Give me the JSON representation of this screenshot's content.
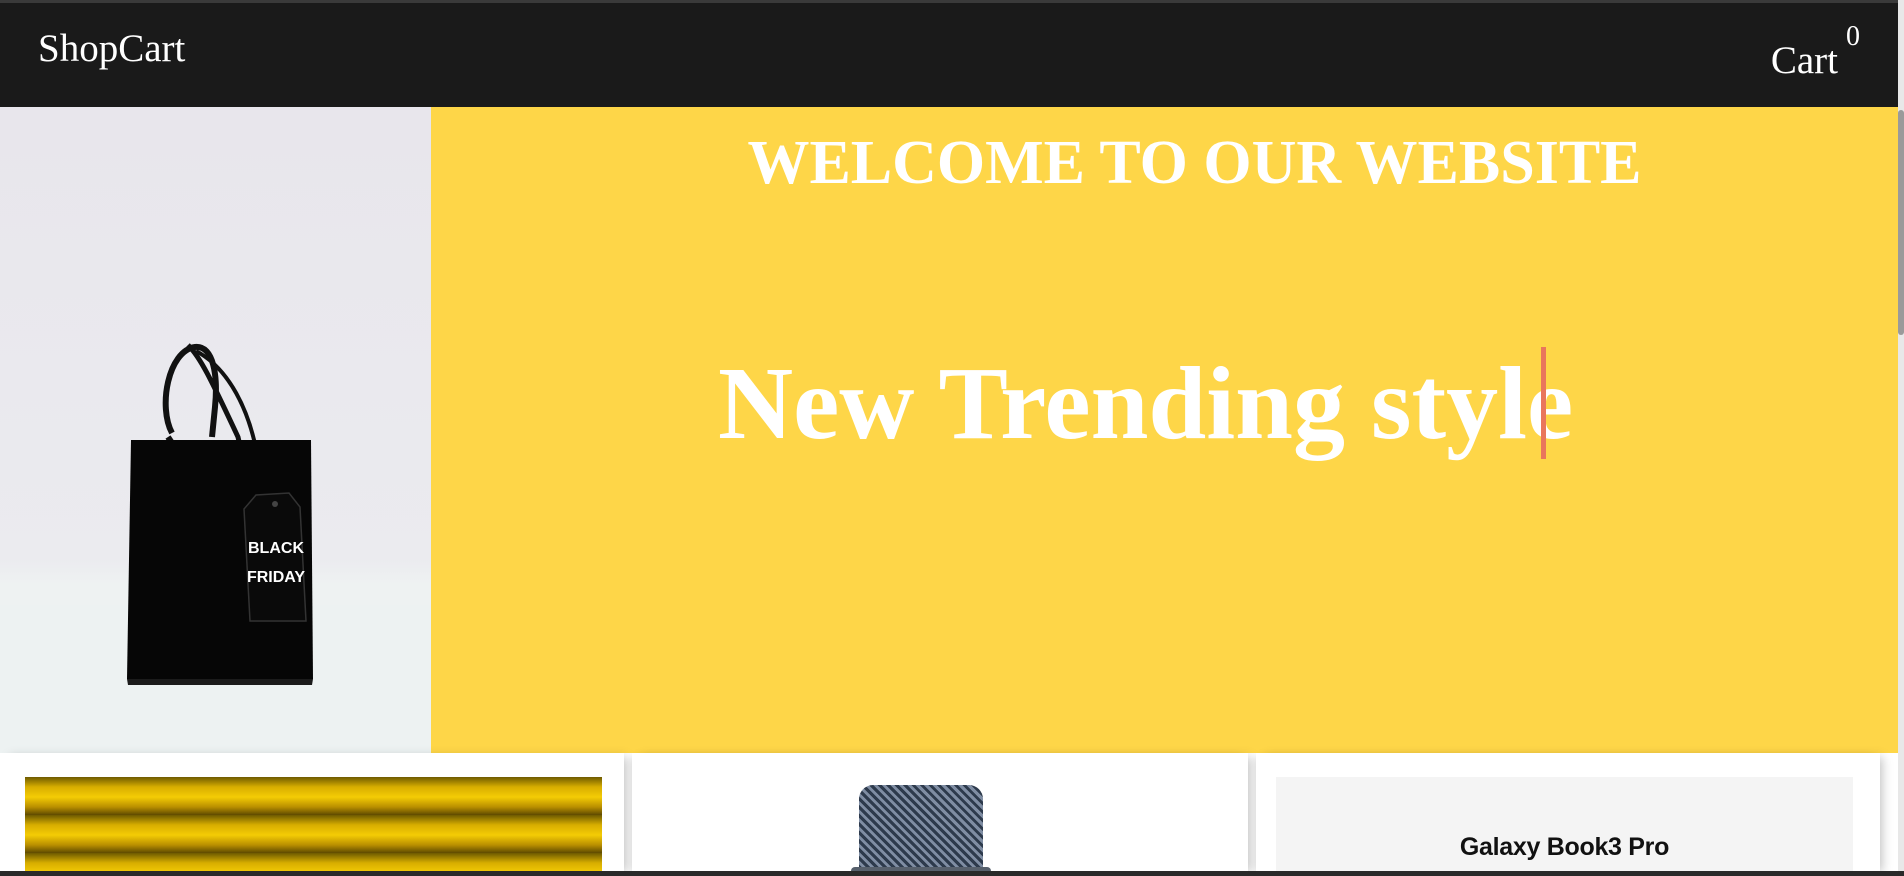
{
  "navbar": {
    "brand": "ShopCart",
    "cart_label": "Cart",
    "cart_count": "0"
  },
  "hero": {
    "welcome": "WELCOME TO OUR WEBSITE",
    "typing_text": "New Trending style",
    "image": {
      "tag_line1": "BLACK",
      "tag_line2": "FRIDAY"
    }
  },
  "products": [
    {
      "image_subject": "yellow-ribbed-texture"
    },
    {
      "image_subject": "smartwatch-mesh-band"
    },
    {
      "image_subject": "laptop",
      "image_text": "Galaxy Book3 Pro"
    }
  ],
  "colors": {
    "navbar": "#1a1a1a",
    "hero_accent": "#fed648",
    "caret": "#e9765c"
  }
}
